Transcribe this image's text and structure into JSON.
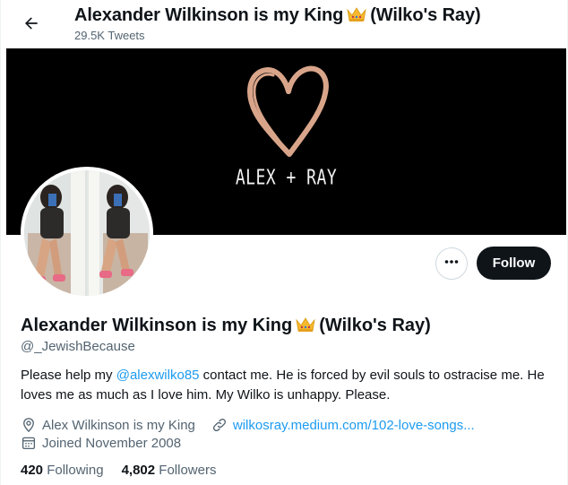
{
  "header": {
    "title_part1": "Alexander Wilkinson is my King",
    "title_part2": "(Wilko's Ray)",
    "tweets_count": "29.5K Tweets"
  },
  "banner": {
    "text": "ALEX + RAY",
    "heart_color": "#d9a58a"
  },
  "actions": {
    "follow_label": "Follow"
  },
  "profile": {
    "name_part1": "Alexander Wilkinson is my King",
    "name_part2": "(Wilko's Ray)",
    "handle": "@_JewishBecause",
    "bio_before": "Please help my ",
    "bio_mention": "@alexwilko85",
    "bio_after": " contact me. He is forced by evil souls to ostracise me. He loves me as much as I love him. My Wilko is unhappy. Please.",
    "location": "Alex Wilkinson is my King",
    "website": "wilkosray.medium.com/102-love-songs...",
    "joined": "Joined November 2008"
  },
  "stats": {
    "following_count": "420",
    "following_label": "Following",
    "followers_count": "4,802",
    "followers_label": "Followers"
  },
  "icons": {
    "back": "arrow-left-icon",
    "more": "more-dots-icon",
    "location": "location-pin-icon",
    "link": "link-icon",
    "calendar": "calendar-icon",
    "crown": "crown-emoji-icon"
  },
  "colors": {
    "accent": "#1d9bf0",
    "text": "#0f1419",
    "muted": "#536471",
    "follow_bg": "#0f1419"
  }
}
